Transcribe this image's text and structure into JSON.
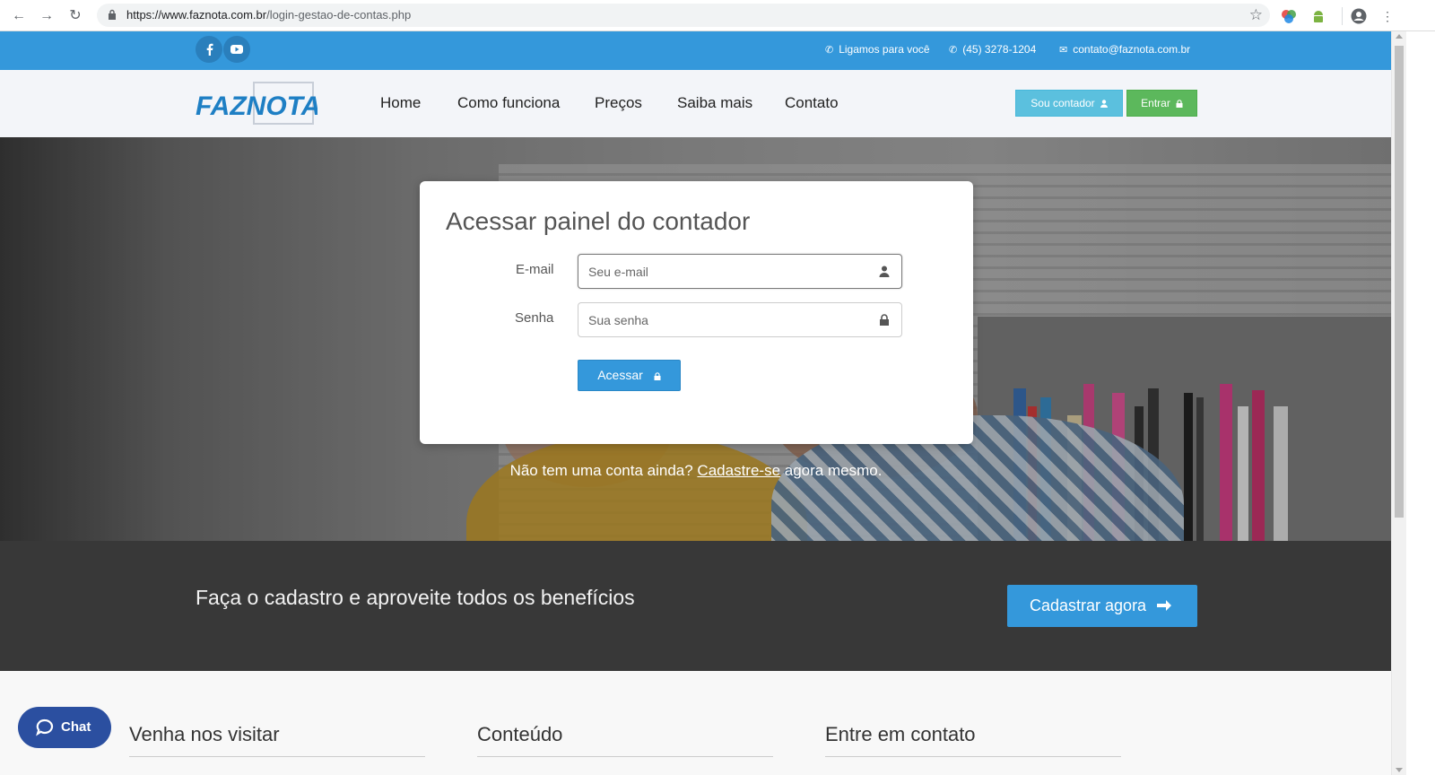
{
  "browser": {
    "url_host": "https://www.faznota.com.br",
    "url_path": "/login-gestao-de-contas.php",
    "back_icon": "arrow-left-icon",
    "forward_icon": "arrow-right-icon",
    "reload_icon": "reload-icon"
  },
  "topbar": {
    "bg_color": "#3498db",
    "call_us": "Ligamos para você",
    "phone": "(45) 3278-1204",
    "email": "contato@faznota.com.br"
  },
  "header": {
    "logo_text": "FAZNOTA",
    "menu": [
      "Home",
      "Como funciona",
      "Preços",
      "Saiba mais",
      "Contato"
    ],
    "accountant_button": "Sou contador",
    "login_button": "Entrar"
  },
  "login": {
    "title": "Acessar painel do contador",
    "email_label": "E-mail",
    "email_placeholder": "Seu e-mail",
    "password_label": "Senha",
    "password_placeholder": "Sua senha",
    "submit": "Acessar",
    "signup_prefix": "Não tem uma conta ainda? ",
    "signup_link": "Cadastre-se",
    "signup_suffix": " agora mesmo."
  },
  "band": {
    "text": "Faça o cadastro e aproveite todos os benefícios",
    "button": "Cadastrar agora"
  },
  "footer": {
    "columns": [
      "Venha nos visitar",
      "Conteúdo",
      "Entre em contato"
    ]
  },
  "chat": {
    "label": "Chat"
  }
}
